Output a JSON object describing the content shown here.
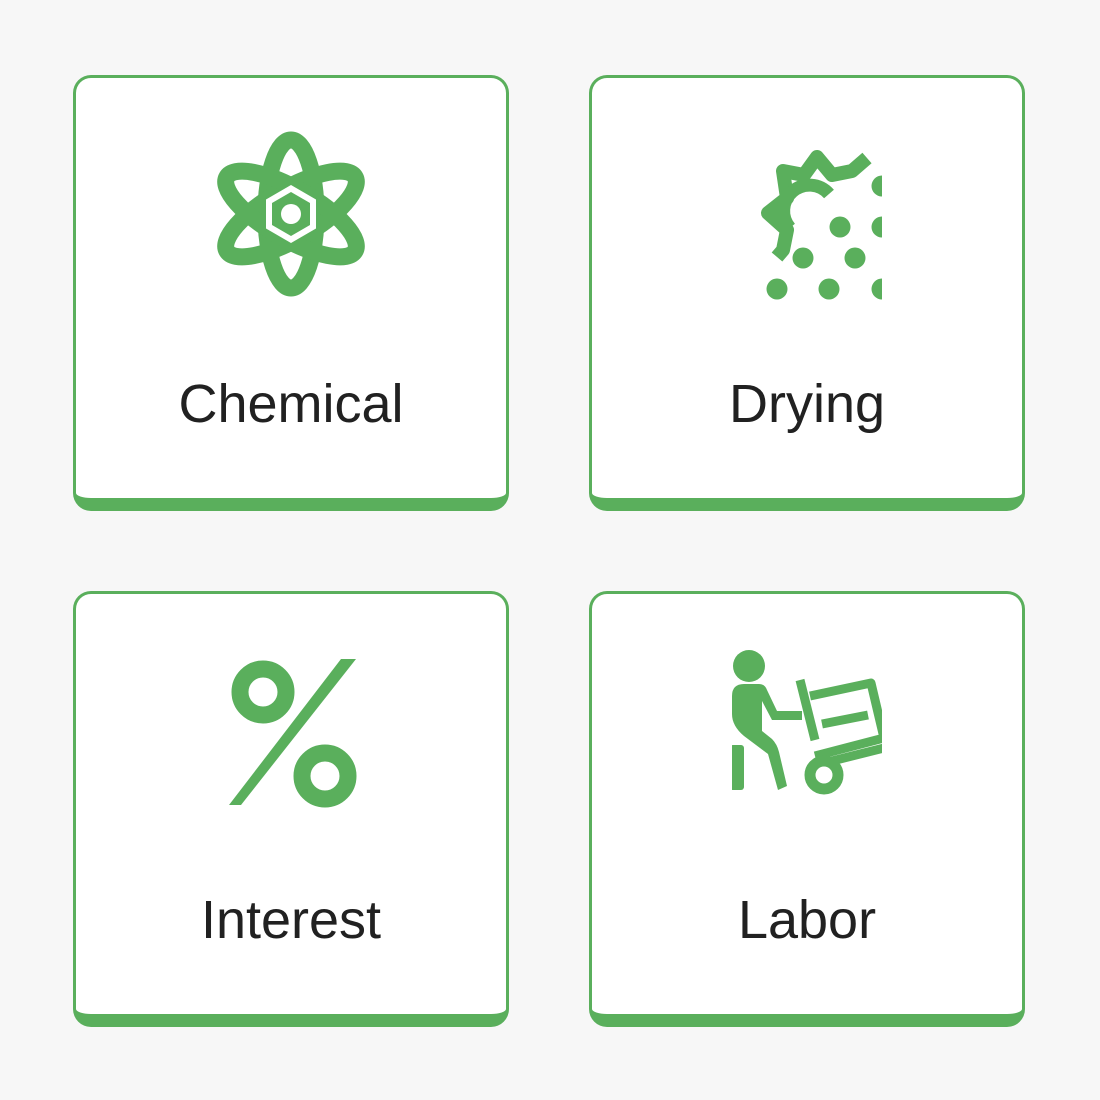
{
  "accent_color": "#5aaf5c",
  "tiles": [
    {
      "label": "Chemical",
      "icon": "atom-icon"
    },
    {
      "label": "Drying",
      "icon": "sun-dots-icon"
    },
    {
      "label": "Interest",
      "icon": "percent-icon"
    },
    {
      "label": "Labor",
      "icon": "hand-truck-worker-icon"
    }
  ]
}
